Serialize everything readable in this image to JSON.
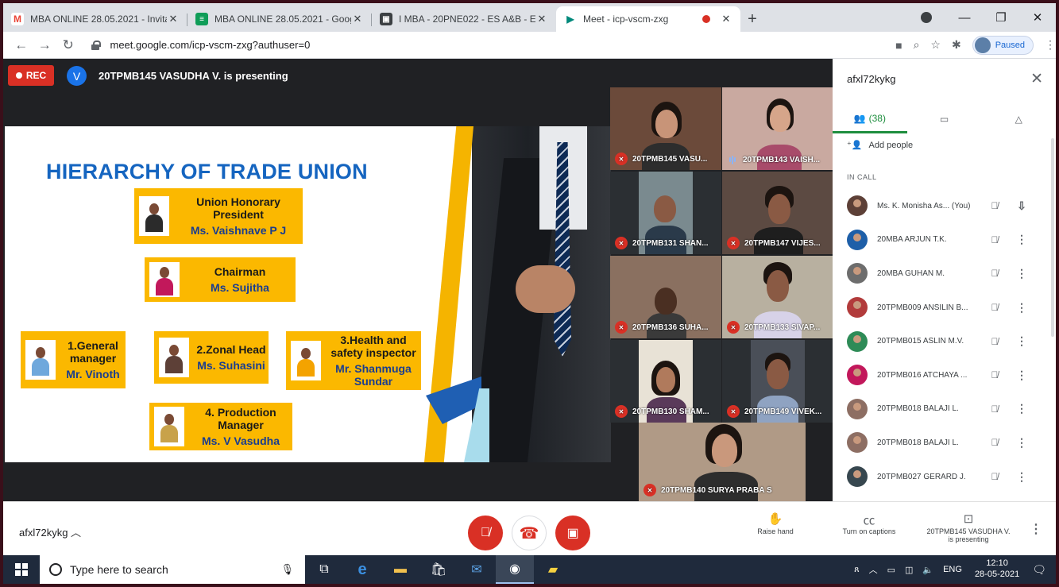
{
  "browser": {
    "tabs": [
      {
        "title": "MBA ONLINE 28.05.2021 - Invita",
        "favicon": "M",
        "favicon_color": "#ea4335",
        "active": false
      },
      {
        "title": "MBA ONLINE 28.05.2021 - Goog",
        "favicon": "≡",
        "favicon_color": "#0f9d58",
        "active": false
      },
      {
        "title": "I MBA - 20PNE022 - ES A&B - En",
        "favicon": "▣",
        "favicon_color": "#3c4043",
        "active": false
      },
      {
        "title": "Meet - icp-vscm-zxg",
        "favicon": "▶",
        "favicon_color": "#00897b",
        "active": true
      }
    ],
    "new_tab": "+",
    "url": "meet.google.com/icp-vscm-zxg?authuser=0",
    "profile_status": "Paused",
    "window_controls": {
      "minimize": "—",
      "restore": "❐",
      "close": "✕"
    }
  },
  "meet": {
    "rec_label": "REC",
    "presenter_initial": "V",
    "presenting_text": "20TPMB145 VASUDHA V. is presenting",
    "meeting_code": "afxl72kykg",
    "participant_count": "(38)"
  },
  "slide": {
    "title": "HIERARCHY OF TRADE UNION",
    "cards": [
      {
        "role": "Union Honorary President",
        "name": "Ms. Vaishnave P J"
      },
      {
        "role": "Chairman",
        "name": "Ms. Sujitha"
      },
      {
        "role": "1.General manager",
        "name": "Mr. Vinoth"
      },
      {
        "role": "2.Zonal Head",
        "name": "Ms. Suhasini"
      },
      {
        "role": "3.Health and safety inspector",
        "name": "Mr. Shanmuga Sundar"
      },
      {
        "role": "4. Production Manager",
        "name": "Ms. V Vasudha"
      }
    ]
  },
  "videos": [
    {
      "label": "20TPMB145 VASU...",
      "speaking": false
    },
    {
      "label": "20TPMB143 VAISH...",
      "speaking": true
    },
    {
      "label": "20TPMB131 SHAN...",
      "speaking": false
    },
    {
      "label": "20TPMB147 VIJES...",
      "speaking": false
    },
    {
      "label": "20TPMB136 SUHA...",
      "speaking": false
    },
    {
      "label": "20TPMB133 SIVAP...",
      "speaking": false
    },
    {
      "label": "20TPMB130 SHAM...",
      "speaking": false
    },
    {
      "label": "20TPMB149 VIVEK...",
      "speaking": false
    },
    {
      "label": "20TPMB140 SURYA PRABA S",
      "speaking": false
    }
  ],
  "panel": {
    "title": "afxl72kykg",
    "add_people": "Add people",
    "section_label": "IN CALL",
    "participants": [
      {
        "name": "Ms. K. Monisha As... (You)",
        "color": "#5d4037",
        "action": "pin-icon"
      },
      {
        "name": "20MBA ARJUN T.K.",
        "color": "#1e5fa8",
        "action": "more-icon"
      },
      {
        "name": "20MBA GUHAN M.",
        "color": "#6d6d6d",
        "action": "more-icon"
      },
      {
        "name": "20TPMB009 ANSILIN B...",
        "color": "#b23b3b",
        "action": "more-icon"
      },
      {
        "name": "20TPMB015 ASLIN M.V.",
        "color": "#2e8b57",
        "action": "more-icon"
      },
      {
        "name": "20TPMB016 ATCHAYA ...",
        "color": "#c2185b",
        "action": "more-icon"
      },
      {
        "name": "20TPMB018 BALAJI L.",
        "color": "#8d6e63",
        "action": "more-icon"
      },
      {
        "name": "20TPMB018 BALAJI L.",
        "color": "#8d6e63",
        "action": "more-icon"
      },
      {
        "name": "20TPMB027 GERARD J.",
        "color": "#37474f",
        "action": "more-icon"
      }
    ]
  },
  "controls": {
    "meeting_code": "afxl72kykg",
    "raise_hand": "Raise hand",
    "captions": "Turn on captions",
    "presenting_line1": "20TPMB145 VASUDHA V.",
    "presenting_line2": "is presenting"
  },
  "taskbar": {
    "search_placeholder": "Type here to search",
    "language": "ENG",
    "time": "12:10",
    "date": "28-05-2021"
  }
}
